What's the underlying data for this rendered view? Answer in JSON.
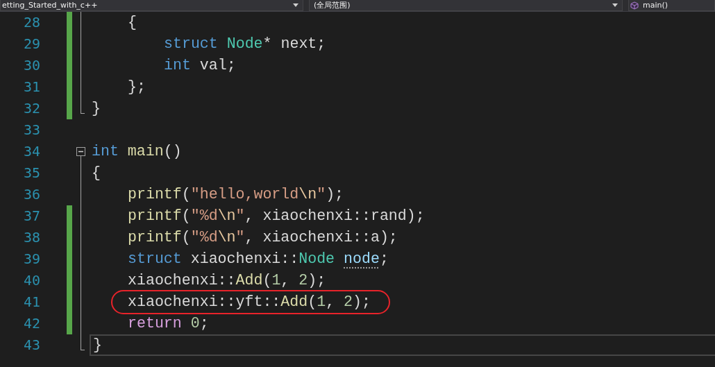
{
  "navigation_bar": [
    {
      "label": "etting_Started_with_c++",
      "kind": "project",
      "caret": true
    },
    {
      "label": "(全局范围)",
      "kind": "scope",
      "caret": true
    },
    {
      "label": "main()",
      "kind": "member",
      "caret": false
    }
  ],
  "lines": [
    {
      "number": "28",
      "changed": true,
      "kind": "span",
      "indented": true,
      "nested": false,
      "current": false,
      "tokens": [
        {
          "t": "{",
          "kind": "plain"
        }
      ]
    },
    {
      "number": "29",
      "changed": true,
      "kind": "span",
      "indented": true,
      "nested": true,
      "current": false,
      "tokens": [
        {
          "t": "struct",
          "kind": "keyword"
        },
        {
          "t": " Node",
          "kind": "type"
        },
        {
          "t": "* next;",
          "kind": "plain"
        }
      ]
    },
    {
      "number": "30",
      "changed": true,
      "kind": "span",
      "indented": true,
      "nested": true,
      "current": false,
      "tokens": [
        {
          "t": "int",
          "kind": "keyword"
        },
        {
          "t": " val;",
          "kind": "plain"
        }
      ]
    },
    {
      "number": "31",
      "changed": true,
      "kind": "span",
      "indented": true,
      "nested": false,
      "current": false,
      "tokens": [
        {
          "t": "};",
          "kind": "plain"
        }
      ]
    },
    {
      "number": "32",
      "changed": true,
      "kind": "end",
      "indented": false,
      "nested": false,
      "current": false,
      "tokens": [
        {
          "t": "}",
          "kind": "plain"
        }
      ]
    },
    {
      "number": "33",
      "changed": false,
      "kind": "blank",
      "current": false
    },
    {
      "number": "34",
      "changed": false,
      "kind": "start",
      "indented": false,
      "nested": false,
      "current": false,
      "tokens": [
        {
          "t": "int",
          "kind": "keyword"
        },
        {
          "t": " main",
          "kind": "function"
        },
        {
          "t": "()",
          "kind": "plain"
        }
      ]
    },
    {
      "number": "35",
      "changed": false,
      "kind": "span",
      "indented": false,
      "nested": false,
      "current": false,
      "tokens": [
        {
          "t": "{",
          "kind": "plain"
        }
      ]
    },
    {
      "number": "36",
      "changed": false,
      "kind": "span",
      "indented": true,
      "nested": false,
      "current": false,
      "tokens": [
        {
          "t": "printf",
          "kind": "function"
        },
        {
          "t": "(",
          "kind": "plain"
        },
        {
          "t": "\"hello,world",
          "kind": "string"
        },
        {
          "t": "\\n",
          "kind": "escape"
        },
        {
          "t": "\"",
          "kind": "string"
        },
        {
          "t": ");",
          "kind": "plain"
        }
      ]
    },
    {
      "number": "37",
      "changed": true,
      "kind": "span",
      "indented": true,
      "nested": false,
      "current": false,
      "tokens": [
        {
          "t": "printf",
          "kind": "function"
        },
        {
          "t": "(",
          "kind": "plain"
        },
        {
          "t": "\"%d",
          "kind": "string"
        },
        {
          "t": "\\n",
          "kind": "escape"
        },
        {
          "t": "\"",
          "kind": "string"
        },
        {
          "t": ", xiaochenxi::rand);",
          "kind": "plain"
        }
      ]
    },
    {
      "number": "38",
      "changed": true,
      "kind": "span",
      "indented": true,
      "nested": false,
      "current": false,
      "tokens": [
        {
          "t": "printf",
          "kind": "function"
        },
        {
          "t": "(",
          "kind": "plain"
        },
        {
          "t": "\"%d",
          "kind": "string"
        },
        {
          "t": "\\n",
          "kind": "escape"
        },
        {
          "t": "\"",
          "kind": "string"
        },
        {
          "t": ", xiaochenxi::a);",
          "kind": "plain"
        }
      ]
    },
    {
      "number": "39",
      "changed": true,
      "kind": "span",
      "indented": true,
      "nested": false,
      "current": false,
      "tokens": [
        {
          "t": "struct",
          "kind": "keyword"
        },
        {
          "t": " xiaochenxi::",
          "kind": "plain"
        },
        {
          "t": "Node ",
          "kind": "type"
        },
        {
          "t": "node",
          "kind": "hinted"
        },
        {
          "t": ";",
          "kind": "plain"
        }
      ]
    },
    {
      "number": "40",
      "changed": true,
      "kind": "span",
      "indented": true,
      "nested": false,
      "current": false,
      "tokens": [
        {
          "t": "xiaochenxi::",
          "kind": "plain"
        },
        {
          "t": "Add",
          "kind": "function"
        },
        {
          "t": "(",
          "kind": "plain"
        },
        {
          "t": "1",
          "kind": "number"
        },
        {
          "t": ", ",
          "kind": "plain"
        },
        {
          "t": "2",
          "kind": "number"
        },
        {
          "t": ");",
          "kind": "plain"
        }
      ]
    },
    {
      "number": "41",
      "changed": true,
      "kind": "span",
      "indented": true,
      "nested": false,
      "current": false,
      "circled": true,
      "tokens": [
        {
          "t": "xiaochenxi::yft::",
          "kind": "plain"
        },
        {
          "t": "Add",
          "kind": "function"
        },
        {
          "t": "(",
          "kind": "plain"
        },
        {
          "t": "1",
          "kind": "number"
        },
        {
          "t": ", ",
          "kind": "plain"
        },
        {
          "t": "2",
          "kind": "number"
        },
        {
          "t": ");",
          "kind": "plain"
        }
      ]
    },
    {
      "number": "42",
      "changed": true,
      "kind": "span",
      "indented": true,
      "nested": false,
      "current": false,
      "tokens": [
        {
          "t": "return ",
          "kind": "control"
        },
        {
          "t": "0",
          "kind": "number"
        },
        {
          "t": ";",
          "kind": "plain"
        }
      ]
    },
    {
      "number": "43",
      "changed": false,
      "kind": "end",
      "indented": false,
      "nested": false,
      "current": true,
      "tokens": [
        {
          "t": "}",
          "kind": "plain"
        }
      ]
    }
  ]
}
